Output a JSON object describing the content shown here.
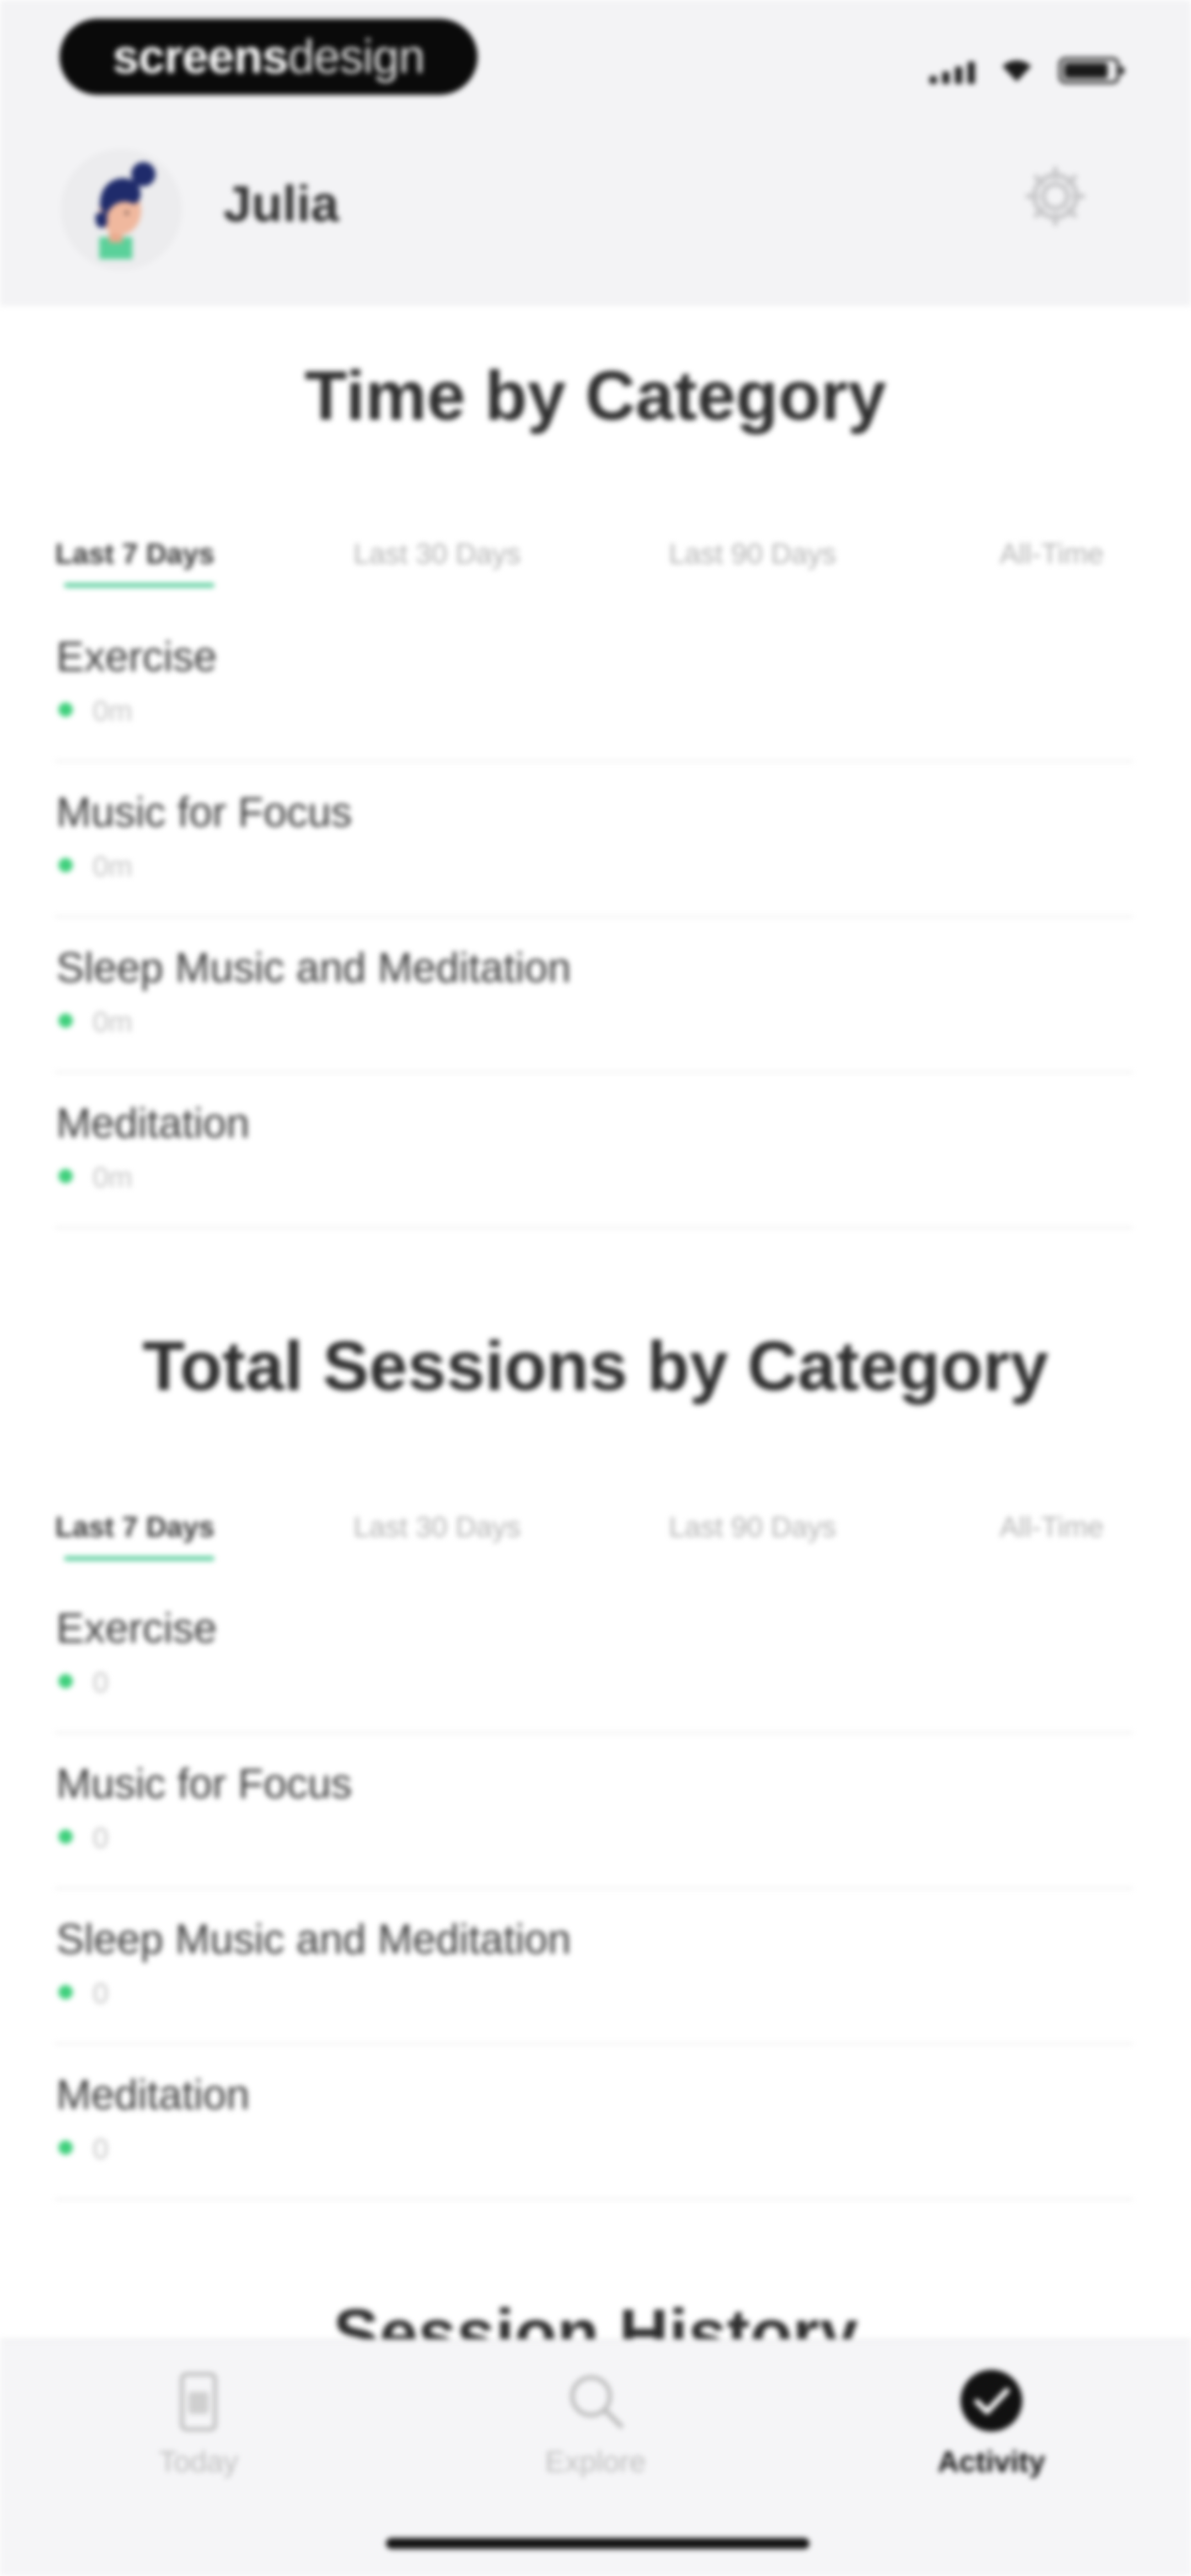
{
  "watermark": {
    "bold": "screens",
    "light": "design"
  },
  "profile": {
    "name": "Julia"
  },
  "icons": {
    "settings": "gear-icon",
    "avatar": "avatar-illustration",
    "today": "today-icon",
    "explore": "search-icon",
    "activity": "checkmark-circle-icon"
  },
  "colors": {
    "accent": "#66d2a4",
    "dot": "#3fd07c",
    "active_tab_text": "#111111"
  },
  "time_section": {
    "title": "Time by Category",
    "tabs": [
      "Last 7 Days",
      "Last 30 Days",
      "Last 90 Days",
      "All-Time"
    ],
    "active_tab": "Last 7 Days",
    "rows": [
      {
        "name": "Exercise",
        "value": "0m"
      },
      {
        "name": "Music for Focus",
        "value": "0m"
      },
      {
        "name": "Sleep Music and Meditation",
        "value": "0m"
      },
      {
        "name": "Meditation",
        "value": "0m"
      }
    ]
  },
  "sessions_section": {
    "title": "Total Sessions by Category",
    "tabs": [
      "Last 7 Days",
      "Last 30 Days",
      "Last 90 Days",
      "All-Time"
    ],
    "active_tab": "Last 7 Days",
    "rows": [
      {
        "name": "Exercise",
        "value": "0"
      },
      {
        "name": "Music for Focus",
        "value": "0"
      },
      {
        "name": "Sleep Music and Meditation",
        "value": "0"
      },
      {
        "name": "Meditation",
        "value": "0"
      }
    ]
  },
  "history_section": {
    "title": "Session History"
  },
  "tab_bar": {
    "items": [
      {
        "label": "Today"
      },
      {
        "label": "Explore"
      },
      {
        "label": "Activity"
      }
    ],
    "active": "Activity"
  }
}
